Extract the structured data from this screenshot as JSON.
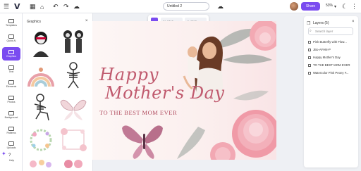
{
  "topbar": {
    "logo": "V",
    "doc_title": "Untitled 2",
    "share_label": "Share",
    "zoom": "53%",
    "icons": [
      "menu-icon",
      "home-icon",
      "undo-icon",
      "redo-icon",
      "cloud-sync-icon",
      "chevron-down-icon",
      "moon-icon",
      "more-icon"
    ]
  },
  "rail": {
    "items": [
      {
        "label": "Templates",
        "icon": "templates-icon"
      },
      {
        "label": "Quick AI",
        "icon": "sparkle-icon"
      },
      {
        "label": "Graphics",
        "icon": "shapes-icon",
        "active": true
      },
      {
        "label": "Text",
        "icon": "text-icon"
      },
      {
        "label": "Elements",
        "icon": "elements-icon"
      },
      {
        "label": "Photos",
        "icon": "photos-icon"
      },
      {
        "label": "Background",
        "icon": "background-icon"
      },
      {
        "label": "Patterns",
        "icon": "patterns-icon"
      },
      {
        "label": "Uploads",
        "icon": "uploads-icon"
      }
    ],
    "help_label": "Help"
  },
  "graphics": {
    "title": "Graphics"
  },
  "toolbar": {
    "width_label": "W: 1740px",
    "height_label": "H: 1240px"
  },
  "canvas": {
    "line1": "Happy",
    "line2": "Mother's Day",
    "tagline": "TO THE BEST MOM EVER"
  },
  "layers": {
    "title": "Layers (5)",
    "search_placeholder": "Search layer",
    "items": [
      "Pink Butterfly with Flow...",
      "JBo-AFHN-P",
      "Happy Mother's Day",
      "TO THE BEST MOM EVER",
      "Watercolor Pink Peony F..."
    ]
  },
  "colors": {
    "accent": "#7a4cf0",
    "title_text": "#c05a6e"
  }
}
